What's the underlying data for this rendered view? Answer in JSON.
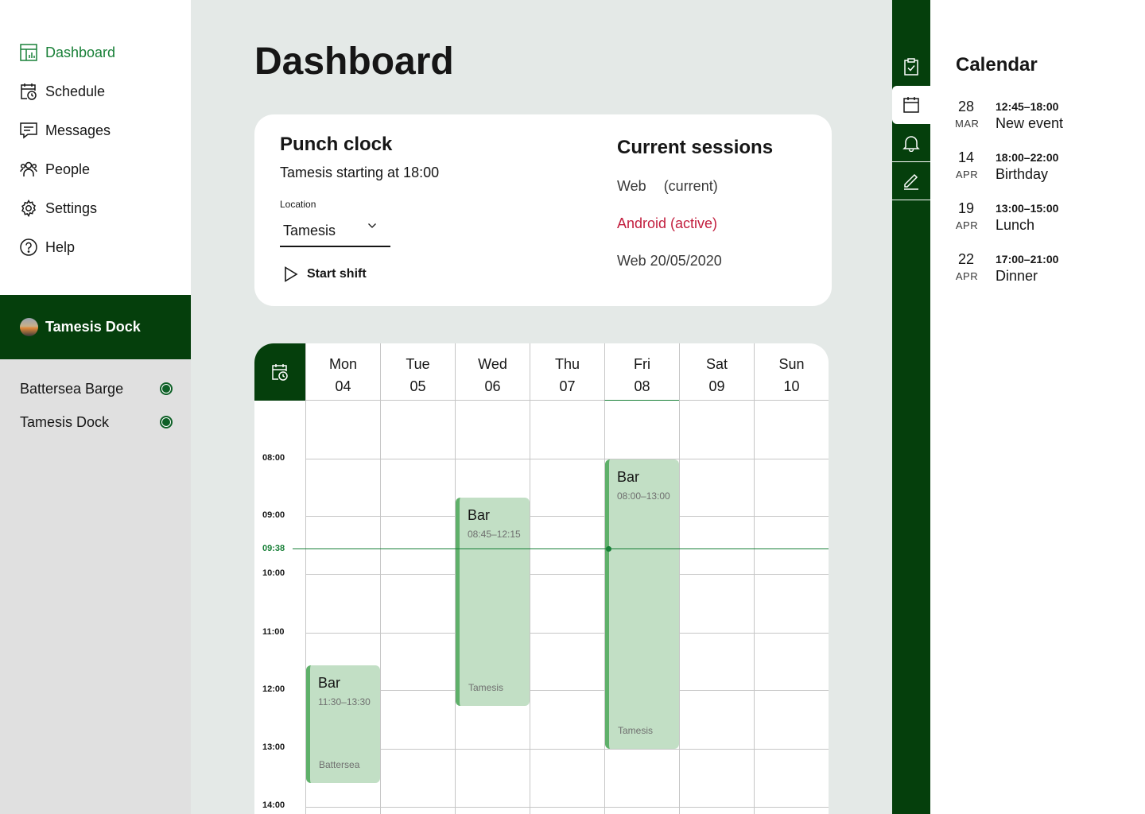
{
  "sidebar": {
    "nav": [
      {
        "label": "Dashboard",
        "icon": "dashboard-icon",
        "active": true
      },
      {
        "label": "Schedule",
        "icon": "schedule-icon"
      },
      {
        "label": "Messages",
        "icon": "messages-icon"
      },
      {
        "label": "People",
        "icon": "people-icon"
      },
      {
        "label": "Settings",
        "icon": "settings-icon"
      },
      {
        "label": "Help",
        "icon": "help-icon"
      }
    ],
    "account": {
      "name": "Tamesis Dock"
    },
    "locations": [
      {
        "name": "Battersea Barge",
        "status": "active"
      },
      {
        "name": "Tamesis Dock",
        "status": "active"
      }
    ]
  },
  "main": {
    "title": "Dashboard",
    "punch_clock": {
      "title": "Punch clock",
      "subtitle": "Tamesis starting at 18:00",
      "location_label": "Location",
      "location_value": "Tamesis",
      "start_label": "Start shift"
    },
    "sessions": {
      "title": "Current sessions",
      "items": [
        {
          "platform": "Web",
          "state": "(current)"
        },
        {
          "text": "Android (active)"
        },
        {
          "text": "Web 20/05/2020"
        }
      ]
    },
    "week": {
      "days": [
        {
          "name": "Mon",
          "date": "04"
        },
        {
          "name": "Tue",
          "date": "05"
        },
        {
          "name": "Wed",
          "date": "06"
        },
        {
          "name": "Thu",
          "date": "07"
        },
        {
          "name": "Fri",
          "date": "08",
          "today": true
        },
        {
          "name": "Sat",
          "date": "09"
        },
        {
          "name": "Sun",
          "date": "10"
        }
      ],
      "hours": [
        "08:00",
        "09:00",
        "10:00",
        "11:00",
        "12:00",
        "13:00",
        "14:00"
      ],
      "now": "09:38",
      "events": [
        {
          "title": "Bar",
          "time": "11:30–13:30",
          "location": "Battersea"
        },
        {
          "title": "Bar",
          "time": "08:45–12:15",
          "location": "Tamesis"
        },
        {
          "title": "Bar",
          "time": "08:00–13:00",
          "location": "Tamesis"
        }
      ]
    }
  },
  "rail": {
    "buttons": [
      "tasks-icon",
      "calendar-icon",
      "notification-icon",
      "edit-icon"
    ]
  },
  "calendar_panel": {
    "title": "Calendar",
    "items": [
      {
        "day": "28",
        "month": "MAR",
        "time": "12:45–18:00",
        "name": "New event"
      },
      {
        "day": "14",
        "month": "APR",
        "time": "18:00–22:00",
        "name": "Birthday"
      },
      {
        "day": "19",
        "month": "APR",
        "time": "13:00–15:00",
        "name": "Lunch"
      },
      {
        "day": "22",
        "month": "APR",
        "time": "17:00–21:00",
        "name": "Dinner"
      }
    ]
  },
  "colors": {
    "brand_dark": "#053f0c",
    "brand": "#198038",
    "event_bg": "#c2dfc5",
    "event_border": "#5fb06a",
    "alert": "#c21e3e"
  }
}
